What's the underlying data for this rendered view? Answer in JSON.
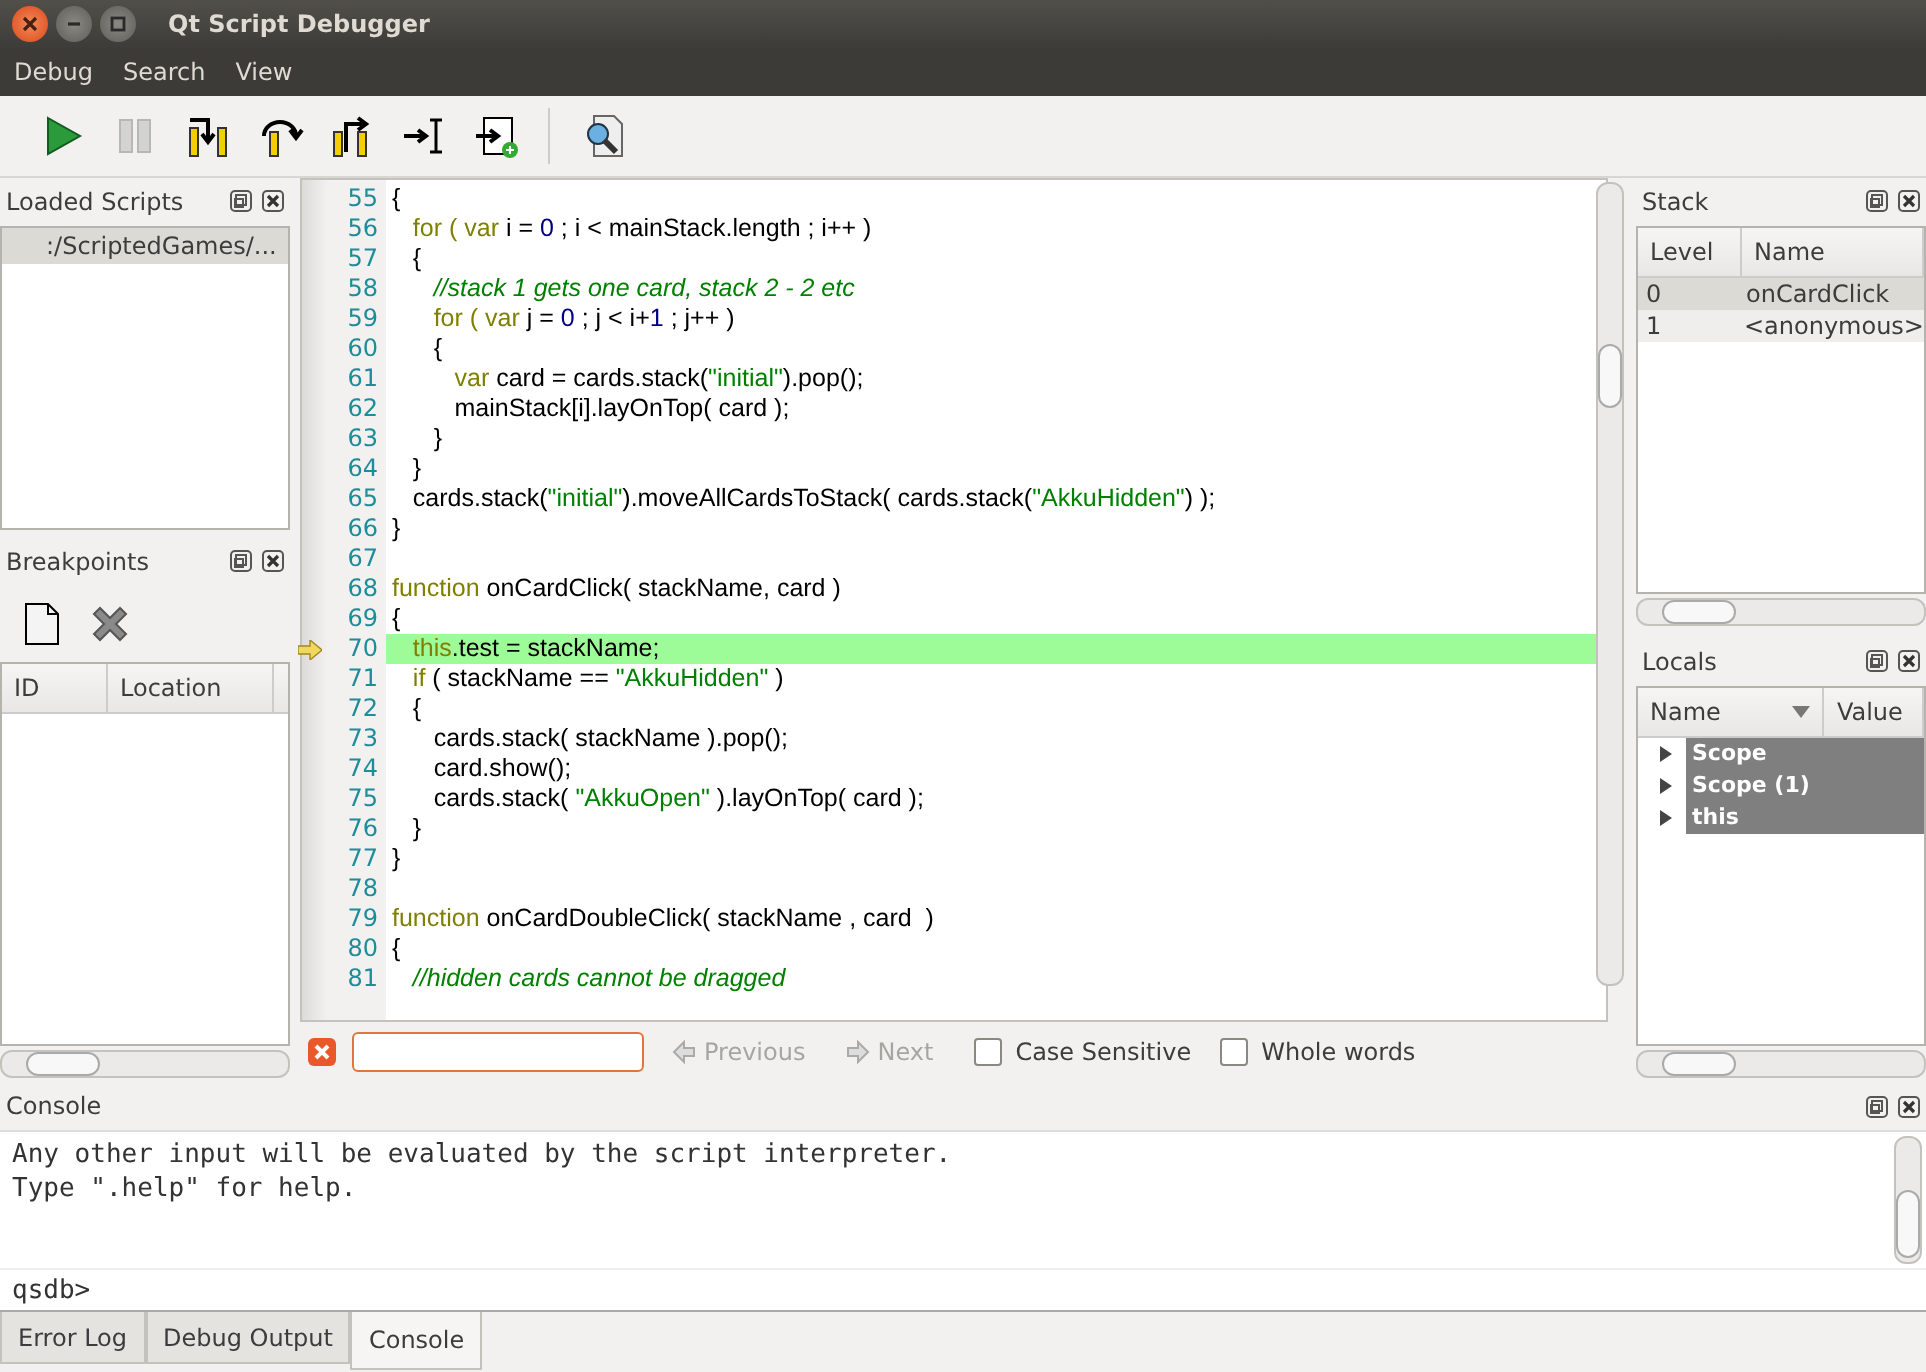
{
  "window": {
    "title": "Qt Script Debugger"
  },
  "menu": [
    "Debug",
    "Search",
    "View"
  ],
  "toolbar": [
    {
      "kind": "continue",
      "disabled": false
    },
    {
      "kind": "interrupt",
      "disabled": true
    },
    {
      "kind": "step_into",
      "disabled": false
    },
    {
      "kind": "step_over",
      "disabled": false
    },
    {
      "kind": "step_out",
      "disabled": false
    },
    {
      "kind": "run_to_cursor",
      "disabled": false
    },
    {
      "kind": "run_to_new_script",
      "disabled": false
    },
    {
      "kind": "find",
      "disabled": false
    }
  ],
  "loaded_scripts": {
    "title": "Loaded Scripts",
    "items": [
      {
        "label": ":/ScriptedGames/...",
        "selected": true
      }
    ]
  },
  "breakpoints": {
    "title": "Breakpoints",
    "columns": [
      "ID",
      "Location"
    ]
  },
  "editor": {
    "lines": [
      {
        "number": "55",
        "current": false,
        "tokens": [
          {
            "kind": "txt",
            "text": "{"
          }
        ]
      },
      {
        "number": "56",
        "current": false,
        "tokens": [
          {
            "kind": "kw",
            "text": "   for ( var "
          },
          {
            "kind": "txt",
            "text": "i = "
          },
          {
            "kind": "num",
            "text": "0"
          },
          {
            "kind": "txt",
            "text": " ; i < mainStack.length ; i++ )"
          }
        ]
      },
      {
        "number": "57",
        "current": false,
        "tokens": [
          {
            "kind": "txt",
            "text": "   {"
          }
        ]
      },
      {
        "number": "58",
        "current": false,
        "tokens": [
          {
            "kind": "com",
            "text": "      //stack 1 gets one card, stack 2 - 2 etc"
          }
        ]
      },
      {
        "number": "59",
        "current": false,
        "tokens": [
          {
            "kind": "kw",
            "text": "      for ( var "
          },
          {
            "kind": "txt",
            "text": "j = "
          },
          {
            "kind": "num",
            "text": "0"
          },
          {
            "kind": "txt",
            "text": " ; j < i+"
          },
          {
            "kind": "num",
            "text": "1"
          },
          {
            "kind": "txt",
            "text": " ; j++ )"
          }
        ]
      },
      {
        "number": "60",
        "current": false,
        "tokens": [
          {
            "kind": "txt",
            "text": "      {"
          }
        ]
      },
      {
        "number": "61",
        "current": false,
        "tokens": [
          {
            "kind": "kw",
            "text": "         var "
          },
          {
            "kind": "txt",
            "text": "card = cards.stack("
          },
          {
            "kind": "str",
            "text": "\"initial\""
          },
          {
            "kind": "txt",
            "text": ").pop();"
          }
        ]
      },
      {
        "number": "62",
        "current": false,
        "tokens": [
          {
            "kind": "txt",
            "text": "         mainStack[i].layOnTop( card );"
          }
        ]
      },
      {
        "number": "63",
        "current": false,
        "tokens": [
          {
            "kind": "txt",
            "text": "      }"
          }
        ]
      },
      {
        "number": "64",
        "current": false,
        "tokens": [
          {
            "kind": "txt",
            "text": "   }"
          }
        ]
      },
      {
        "number": "65",
        "current": false,
        "tokens": [
          {
            "kind": "txt",
            "text": "   cards.stack("
          },
          {
            "kind": "str",
            "text": "\"initial\""
          },
          {
            "kind": "txt",
            "text": ").moveAllCardsToStack( cards.stack("
          },
          {
            "kind": "str",
            "text": "\"AkkuHidden\""
          },
          {
            "kind": "txt",
            "text": ") );"
          }
        ]
      },
      {
        "number": "66",
        "current": false,
        "tokens": [
          {
            "kind": "txt",
            "text": "}"
          }
        ]
      },
      {
        "number": "67",
        "current": false
      },
      {
        "number": "68",
        "current": false,
        "tokens": [
          {
            "kind": "kw",
            "text": "function "
          },
          {
            "kind": "txt",
            "text": "onCardClick( stackName, card )"
          }
        ]
      },
      {
        "number": "69",
        "current": false,
        "tokens": [
          {
            "kind": "txt",
            "text": "{"
          }
        ]
      },
      {
        "number": "70",
        "current": true,
        "tokens": [
          {
            "kind": "kw",
            "text": "   this"
          },
          {
            "kind": "txt",
            "text": ".test = stackName;"
          }
        ]
      },
      {
        "number": "71",
        "current": false,
        "tokens": [
          {
            "kind": "kw",
            "text": "   if "
          },
          {
            "kind": "txt",
            "text": "( stackName == "
          },
          {
            "kind": "str",
            "text": "\"AkkuHidden\""
          },
          {
            "kind": "txt",
            "text": " )"
          }
        ]
      },
      {
        "number": "72",
        "current": false,
        "tokens": [
          {
            "kind": "txt",
            "text": "   {"
          }
        ]
      },
      {
        "number": "73",
        "current": false,
        "tokens": [
          {
            "kind": "txt",
            "text": "      cards.stack( stackName ).pop();"
          }
        ]
      },
      {
        "number": "74",
        "current": false,
        "tokens": [
          {
            "kind": "txt",
            "text": "      card.show();"
          }
        ]
      },
      {
        "number": "75",
        "current": false,
        "tokens": [
          {
            "kind": "txt",
            "text": "      cards.stack( "
          },
          {
            "kind": "str",
            "text": "\"AkkuOpen\""
          },
          {
            "kind": "txt",
            "text": " ).layOnTop( card );"
          }
        ]
      },
      {
        "number": "76",
        "current": false,
        "tokens": [
          {
            "kind": "txt",
            "text": "   }"
          }
        ]
      },
      {
        "number": "77",
        "current": false,
        "tokens": [
          {
            "kind": "txt",
            "text": "}"
          }
        ]
      },
      {
        "number": "78",
        "current": false
      },
      {
        "number": "79",
        "current": false,
        "tokens": [
          {
            "kind": "kw",
            "text": "function "
          },
          {
            "kind": "txt",
            "text": "onCardDoubleClick( stackName , card  )"
          }
        ]
      },
      {
        "number": "80",
        "current": false,
        "tokens": [
          {
            "kind": "txt",
            "text": "{"
          }
        ]
      },
      {
        "number": "81",
        "current": false,
        "tokens": [
          {
            "kind": "com",
            "text": "   //hidden cards cannot be dragged"
          }
        ]
      }
    ]
  },
  "find_bar": {
    "previous": {
      "label": "Previous",
      "disabled": true
    },
    "next": {
      "label": "Next",
      "disabled": true
    },
    "options": [
      {
        "label": "Case Sensitive",
        "checked": false
      },
      {
        "label": "Whole words",
        "checked": false
      }
    ]
  },
  "stack": {
    "title": "Stack",
    "columns": [
      "Level",
      "Name"
    ],
    "rows": [
      {
        "level": "0",
        "name": "onCardClick",
        "selected": true
      },
      {
        "level": "1",
        "name": "<anonymous>",
        "selected": false
      }
    ]
  },
  "locals": {
    "title": "Locals",
    "columns": [
      "Name",
      "Value"
    ],
    "rows": [
      {
        "name": "Scope",
        "expanded": false,
        "selected": true
      },
      {
        "name": "Scope (1)",
        "expanded": false,
        "selected": true
      },
      {
        "name": "this",
        "expanded": false,
        "selected": true
      }
    ]
  },
  "console": {
    "title": "Console",
    "output": [
      "Any other input will be evaluated by the script interpreter.",
      "Type \".help\" for help."
    ],
    "prompt": "qsdb>"
  },
  "bottom_tabs": [
    {
      "label": "Error Log",
      "selected": false
    },
    {
      "label": "Debug Output",
      "selected": false
    },
    {
      "label": "Console",
      "selected": true
    }
  ]
}
